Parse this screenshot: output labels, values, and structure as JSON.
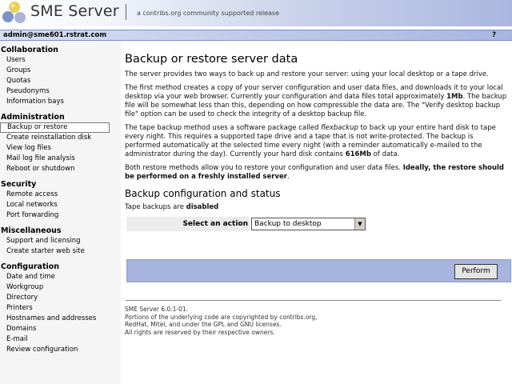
{
  "header": {
    "brand": "SME Server",
    "tagline": "a contribs.org community supported release"
  },
  "userbar": {
    "user": "admin@sme601.rstrat.com",
    "help": "?"
  },
  "sidebar": {
    "sections": [
      {
        "title": "Collaboration",
        "items": [
          "Users",
          "Groups",
          "Quotas",
          "Pseudonyms",
          "Information bays"
        ]
      },
      {
        "title": "Administration",
        "items": [
          "Backup or restore",
          "Create reinstallation disk",
          "View log files",
          "Mail log file analysis",
          "Reboot or shutdown"
        ]
      },
      {
        "title": "Security",
        "items": [
          "Remote access",
          "Local networks",
          "Port forwarding"
        ]
      },
      {
        "title": "Miscellaneous",
        "items": [
          "Support and licensing",
          "Create starter web site"
        ]
      },
      {
        "title": "Configuration",
        "items": [
          "Date and time",
          "Workgroup",
          "Directory",
          "Printers",
          "Hostnames and addresses",
          "Domains",
          "E-mail",
          "Review configuration"
        ]
      }
    ],
    "active_item": "Backup or restore"
  },
  "main": {
    "title": "Backup or restore server data",
    "p1": "The server provides two ways to back up and restore your server: using your local desktop or a tape drive.",
    "p2_a": "The first method creates a copy of your server configuration and user data files, and downloads it to your local desktop via your web browser. Currently your configuration and data files total approximately ",
    "p2_b": "1Mb",
    "p2_c": ". The backup file will be somewhat less than this, depending on how compressible the data are. The \"Verify desktop backup file\" option can be used to check the integrity of a desktop backup file.",
    "p3_a": "The tape backup method uses a software package called ",
    "p3_b": "flexbackup",
    "p3_c": " to back up your entire hard disk to tape every night. This requires a supported tape drive and a tape that is not write-protected. The backup is performed automatically at the selected time every night (with a reminder automatically e-mailed to the administrator during the day). Currently your hard disk contains ",
    "p3_d": "616Mb",
    "p3_e": " of data.",
    "p4_a": "Both restore methods allow you to restore your configuration and user data files. ",
    "p4_b": "Ideally, the restore should be performed on a freshly installed server",
    "p4_c": ".",
    "subtitle": "Backup configuration and status",
    "tape_a": "Tape backups are ",
    "tape_b": "disabled",
    "action_label": "Select an action",
    "action_value": "Backup to desktop",
    "perform": "Perform"
  },
  "footer": {
    "line1": "SME Server 6.0.1-01.",
    "line2": "Portions of the underlying code are copyrighted by contribs.org,",
    "line3": "RedHat, Mitel, and under the GPL and GNU licenses.",
    "line4": "All rights are reserved by their respective owners."
  }
}
